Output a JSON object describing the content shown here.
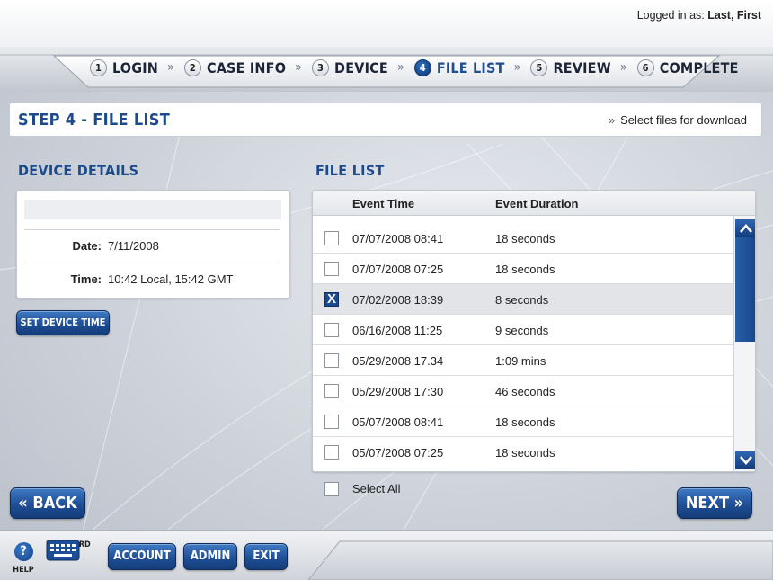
{
  "header": {
    "logged_in_label": "Logged in as:",
    "user_name": "Last, First"
  },
  "steps": [
    {
      "num": "1",
      "label": "LOGIN"
    },
    {
      "num": "2",
      "label": "CASE INFO"
    },
    {
      "num": "3",
      "label": "DEVICE"
    },
    {
      "num": "4",
      "label": "FILE LIST"
    },
    {
      "num": "5",
      "label": "REVIEW"
    },
    {
      "num": "6",
      "label": "COMPLETE"
    }
  ],
  "step_separator": "»",
  "current_step": "4",
  "page": {
    "title": "STEP 4 - FILE LIST",
    "hint_chevron": "»",
    "hint": "Select files for download"
  },
  "device_details": {
    "heading": "DEVICE DETAILS",
    "date_label": "Date:",
    "date_value": "7/11/2008",
    "time_label": "Time:",
    "time_value": "10:42 Local, 15:42 GMT",
    "set_time_button": "SET DEVICE TIME"
  },
  "file_list": {
    "heading": "FILE LIST",
    "col_time": "Event Time",
    "col_duration": "Event Duration",
    "rows": [
      {
        "time": "07/07/2008 08:41",
        "duration": "18 seconds",
        "checked": false
      },
      {
        "time": "07/07/2008 07:25",
        "duration": "18 seconds",
        "checked": false
      },
      {
        "time": "07/02/2008 18:39",
        "duration": "8 seconds",
        "checked": true
      },
      {
        "time": "06/16/2008 11:25",
        "duration": "9 seconds",
        "checked": false
      },
      {
        "time": "05/29/2008 17.34",
        "duration": "1:09 mins",
        "checked": false
      },
      {
        "time": "05/29/2008 17:30",
        "duration": "46 seconds",
        "checked": false
      },
      {
        "time": "05/07/2008 08:41",
        "duration": "18 seconds",
        "checked": false
      },
      {
        "time": "05/07/2008 07:25",
        "duration": "18 seconds",
        "checked": false
      }
    ],
    "check_mark": "X",
    "select_all": "Select All"
  },
  "nav": {
    "back": "« BACK",
    "next": "NEXT »"
  },
  "footer": {
    "help_icon_glyph": "?",
    "help": "HELP",
    "keyboard": "KEYBOARD",
    "account": "ACCOUNT",
    "admin": "ADMIN",
    "exit": "EXIT"
  },
  "colors": {
    "accent_blue": "#1c4a8a",
    "button_blue": "#1f4f96",
    "background": "#c9ced6"
  }
}
